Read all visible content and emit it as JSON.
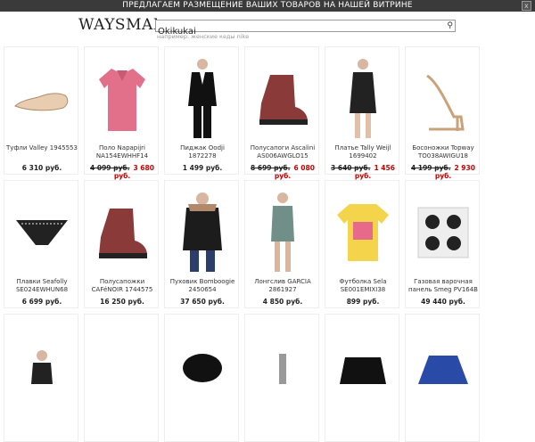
{
  "banner": {
    "text": "ПРЕДЛАГАЕМ РАЗМЕЩЕНИЕ ВАШИХ ТОВАРОВ НА НАШЕЙ ВИТРИНЕ",
    "close": "x"
  },
  "logo": {
    "text": "WAYSMART"
  },
  "search": {
    "value": "Okikukai",
    "hint": "например: женские кеды nike",
    "button_icon": "magnifier-icon"
  },
  "products": [
    {
      "name": "Туфли Valley 1945553",
      "price": "6 310 руб.",
      "old": "",
      "new": "",
      "icon": "shoe-icon"
    },
    {
      "name": "Поло Napapijri NA154EWHHF14",
      "price": "",
      "old": "4 099 руб.",
      "new": "3 680 руб.",
      "icon": "polo-shirt-icon"
    },
    {
      "name": "Пиджак Oodji 1872278",
      "price": "1 499 руб.",
      "old": "",
      "new": "",
      "icon": "suit-icon"
    },
    {
      "name": "Полусапоги Ascalini AS006AWGLO15",
      "price": "",
      "old": "8 699 руб.",
      "new": "6 080 руб.",
      "icon": "boot-icon"
    },
    {
      "name": "Платье Tally Weijl 1699402",
      "price": "",
      "old": "3 640 руб.",
      "new": "1 456 руб.",
      "icon": "dress-icon"
    },
    {
      "name": "Босоножки Topway TO038AWIGU18",
      "price": "",
      "old": "4 199 руб.",
      "new": "2 930 руб.",
      "icon": "sandal-icon"
    },
    {
      "name": "Плавки Seafolly SE024EWHUN68",
      "price": "6 699 руб.",
      "old": "",
      "new": "",
      "icon": "swim-bottom-icon"
    },
    {
      "name": "Полусапожки CAFéNOIR 1744575",
      "price": "16 250 руб.",
      "old": "",
      "new": "",
      "icon": "boot-icon"
    },
    {
      "name": "Пуховик Bomboogie 2450654",
      "price": "37 650 руб.",
      "old": "",
      "new": "",
      "icon": "jacket-icon"
    },
    {
      "name": "Лонгслив GARCIA 2861927",
      "price": "4 850 руб.",
      "old": "",
      "new": "",
      "icon": "longsleeve-icon"
    },
    {
      "name": "Футболка Sela SE001EMIXI38",
      "price": "899 руб.",
      "old": "",
      "new": "",
      "icon": "tshirt-icon"
    },
    {
      "name": "Газовая варочная панель Smeg PV164B",
      "price": "49 440 руб.",
      "old": "",
      "new": "",
      "icon": "gas-hob-icon"
    },
    {
      "name": "",
      "price": "",
      "old": "",
      "new": "",
      "icon": "top-icon"
    },
    {
      "name": "",
      "price": "",
      "old": "",
      "new": "",
      "icon": "blank-icon"
    },
    {
      "name": "",
      "price": "",
      "old": "",
      "new": "",
      "icon": "scarf-icon"
    },
    {
      "name": "",
      "price": "",
      "old": "",
      "new": "",
      "icon": "bottle-icon"
    },
    {
      "name": "",
      "price": "",
      "old": "",
      "new": "",
      "icon": "leather-jacket-icon"
    },
    {
      "name": "",
      "price": "",
      "old": "",
      "new": "",
      "icon": "sweater-icon"
    }
  ]
}
